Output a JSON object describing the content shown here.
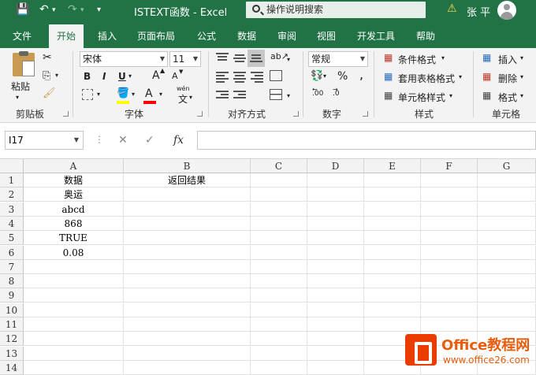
{
  "titlebar": {
    "title": "ISTEXT函数  -  Excel",
    "search_text": "操作说明搜索",
    "user": "张 平",
    "icons": [
      "save-icon",
      "undo-icon",
      "redo-icon",
      "customize-icon",
      "search-icon",
      "warning-icon",
      "avatar"
    ]
  },
  "tabs": [
    "文件",
    "开始",
    "插入",
    "页面布局",
    "公式",
    "数据",
    "审阅",
    "视图",
    "开发工具",
    "帮助"
  ],
  "active_tab": "开始",
  "ribbon": {
    "clipboard": {
      "paste": "粘贴",
      "label": "剪贴板"
    },
    "font": {
      "name": "宋体",
      "size": "11",
      "bold": "B",
      "italic": "I",
      "underline": "U",
      "grow": "A",
      "shrink": "A",
      "fontcolor": "A",
      "wen": "wén",
      "wen_char": "文",
      "label": "字体"
    },
    "alignment": {
      "label": "对齐方式"
    },
    "number": {
      "format": "常规",
      "percent": "%",
      "comma": ",",
      "label": "数字",
      "dec_inc": ".00",
      "dec_dec": ".0"
    },
    "styles": {
      "conditional": "条件格式",
      "table": "套用表格格式",
      "cell": "单元格样式",
      "label": "样式"
    },
    "cells": {
      "insert": "插入",
      "delete": "删除",
      "format": "格式",
      "label": "单元格"
    }
  },
  "formula_bar": {
    "name_box": "I17",
    "cancel": "✕",
    "enter": "✓",
    "fx": "fx",
    "value": ""
  },
  "sheet": {
    "columns": [
      "A",
      "B",
      "C",
      "D",
      "E",
      "F",
      "G"
    ],
    "rows": [
      "1",
      "2",
      "3",
      "4",
      "5",
      "6",
      "7",
      "8",
      "9",
      "10",
      "11",
      "12",
      "13",
      "14"
    ],
    "cells": {
      "A1": "数据",
      "B1": "返回结果",
      "A2": "奥运",
      "A3": "abcd",
      "A4": "868",
      "A5": "TRUE",
      "A6": "0.08"
    }
  },
  "watermark": {
    "title": "Office教程网",
    "url": "www.office26.com"
  }
}
